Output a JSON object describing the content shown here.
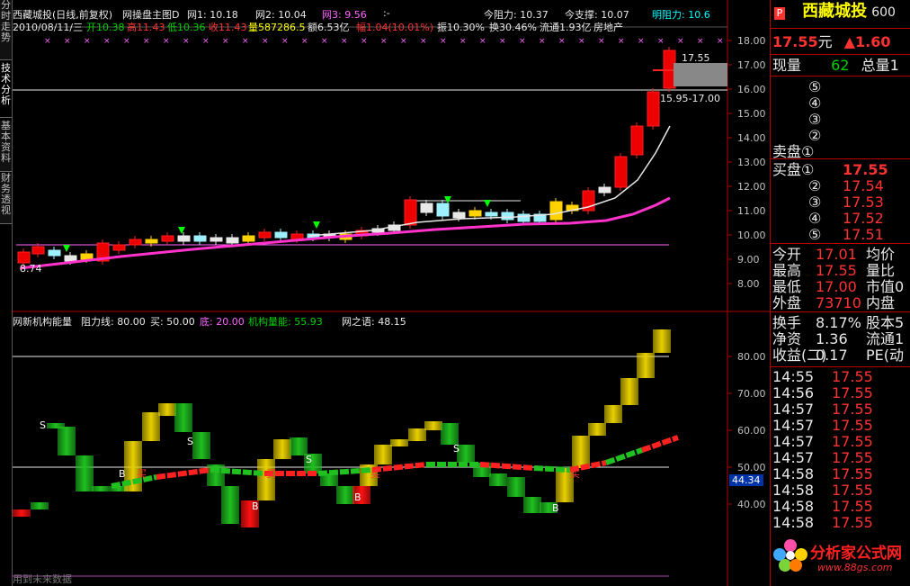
{
  "left_tabs": [
    {
      "label": "分时走势",
      "active": false
    },
    {
      "label": "技术分析",
      "active": true
    },
    {
      "label": "基本资料",
      "active": false
    },
    {
      "label": "财务透视",
      "active": false
    }
  ],
  "header": {
    "title": "西藏城投(日线,前复权)",
    "indicator": "网操盘主图D",
    "w1": "网1: 10.18",
    "w2": "网2: 10.04",
    "w3": "网3: 9.56",
    "dots": ":-",
    "today_resist": "今阻力: 10.37",
    "today_support": "今支撑: 10.07",
    "tomorrow_resist": "明阻力: 10.6"
  },
  "quote_line": {
    "date": "2010/08/11/三",
    "open": "开10.38",
    "high": "高11.43",
    "low": "低10.36",
    "close": "收11.43",
    "volume": "量587286.5",
    "amount": "额6.53亿",
    "change": "幅1.04(10.01%)",
    "amplitude": "振10.30%",
    "turnover": "换30.46%",
    "float": "流通1.93亿",
    "sector": "房地产"
  },
  "price_axis": [
    "18.00",
    "17.00",
    "16.00",
    "15.00",
    "14.00",
    "13.00",
    "12.00",
    "11.00",
    "10.00",
    "9.00",
    "8.00"
  ],
  "price_annotations": {
    "high_label": "17.55",
    "range_label": "15.95-17.00",
    "low_label": "8.74"
  },
  "sub_header": {
    "name": "网新机构能量",
    "resist": "阻力线: 80.00",
    "buy": "买: 50.00",
    "bottom": "底: 20.00",
    "inst": "机构量能: 55.93",
    "words": "网之语: 48.15"
  },
  "sub_axis": [
    "80.00",
    "70.00",
    "60.00",
    "50.00",
    "40.00"
  ],
  "sub_current": "44.34",
  "footer_text": "用到未来数据",
  "panel": {
    "name": "西藏城投",
    "code": "600",
    "price": "17.55",
    "unit": "元",
    "change": "▲1.60",
    "now_label": "现量",
    "now_value": "62",
    "total_label": "总量1",
    "sell_rows": [
      {
        "label": "⑤",
        "price": "",
        "vol": ""
      },
      {
        "label": "④",
        "price": "",
        "vol": ""
      },
      {
        "label": "③",
        "price": "",
        "vol": ""
      },
      {
        "label": "②",
        "price": "",
        "vol": ""
      },
      {
        "label": "卖盘①",
        "price": "",
        "vol": ""
      }
    ],
    "buy_rows": [
      {
        "label": "买盘①",
        "price": "17.55"
      },
      {
        "label": "②",
        "price": "17.54"
      },
      {
        "label": "③",
        "price": "17.53"
      },
      {
        "label": "④",
        "price": "17.52"
      },
      {
        "label": "⑤",
        "price": "17.51"
      }
    ],
    "stats": [
      {
        "l1": "今开",
        "v1": "17.01",
        "l2": "均价"
      },
      {
        "l1": "最高",
        "v1": "17.55",
        "l2": "量比"
      },
      {
        "l1": "最低",
        "v1": "17.00",
        "l2": "市值0"
      },
      {
        "l1": "外盘",
        "v1": "73710",
        "l2": "内盘"
      }
    ],
    "stats2": [
      {
        "l1": "换手",
        "v1": "8.17%",
        "l2": "股本5"
      },
      {
        "l1": "净资",
        "v1": "1.36",
        "l2": "流通1"
      },
      {
        "l1": "收益(二)",
        "v1": "0.17",
        "l2": "PE(动"
      }
    ],
    "ticks": [
      {
        "time": "14:55",
        "price": "17.55"
      },
      {
        "time": "14:56",
        "price": "17.55"
      },
      {
        "time": "14:57",
        "price": "17.55"
      },
      {
        "time": "14:57",
        "price": "17.55"
      },
      {
        "time": "14:57",
        "price": "17.55"
      },
      {
        "time": "14:57",
        "price": "17.55"
      },
      {
        "time": "14:58",
        "price": "17.55"
      },
      {
        "time": "14:58",
        "price": "17.55"
      },
      {
        "time": "14:58",
        "price": "17.55"
      },
      {
        "time": "14:58",
        "price": "17.55"
      }
    ],
    "logo_text": "分析家公式网",
    "logo_url": "www.88gs.com"
  },
  "colors": {
    "up": "#ff3232",
    "down": "#00d000",
    "ma": "#ff00ff",
    "panel_border": "#b00000"
  }
}
